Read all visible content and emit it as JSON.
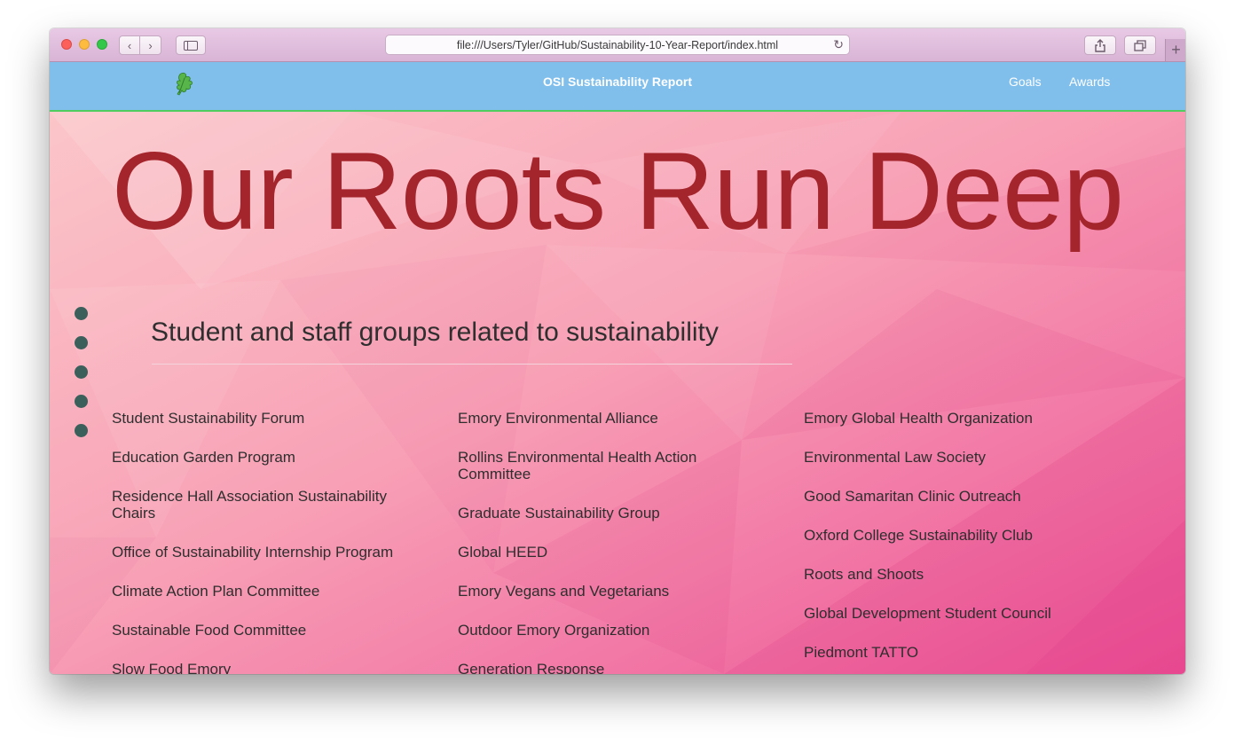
{
  "browser": {
    "url": "file:///Users/Tyler/GitHub/Sustainability-10-Year-Report/index.html"
  },
  "site": {
    "title": "OSI Sustainability Report",
    "nav": [
      "Goals",
      "Awards"
    ],
    "logo_icon": "leaf-logo-icon"
  },
  "hero": {
    "heading": "Our Roots Run Deep"
  },
  "section": {
    "title": "Student and staff groups related to sustainability",
    "dots_count": 5,
    "columns": [
      [
        "Student Sustainability Forum",
        "Education Garden Program",
        "Residence Hall Association Sustainability Chairs",
        "Office of Sustainability Internship Program",
        "Climate Action Plan Committee",
        "Sustainable Food Committee",
        "Slow Food Emory"
      ],
      [
        "Emory Environmental Alliance",
        "Rollins Environmental Health Action Committee",
        "Graduate Sustainability Group",
        "Global HEED",
        "Emory Vegans and Vegetarians",
        "Outdoor Emory Organization",
        "Generation Response"
      ],
      [
        "Emory Global Health Organization",
        "Environmental Law Society",
        "Good Samaritan Clinic Outreach",
        "Oxford College Sustainability Club",
        "Roots and Shoots",
        "Global Development Student Council",
        "Piedmont TATTO"
      ]
    ]
  },
  "colors": {
    "nav_bar": "#80bfec",
    "nav_border": "#4fce5f",
    "hero_text": "#a4252b",
    "dot": "#3b605b",
    "background_top": "#fbc6c9",
    "background_bottom": "#ec5196"
  }
}
